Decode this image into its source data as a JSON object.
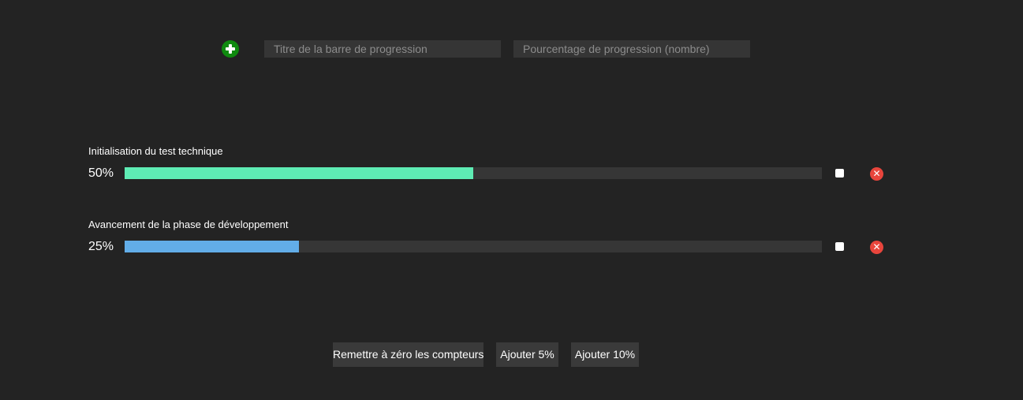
{
  "form": {
    "title_placeholder": "Titre de la barre de progression",
    "percent_placeholder": "Pourcentage de progression (nombre)",
    "add_icon": "plus-circle-icon",
    "add_color": "#0f8a0f"
  },
  "bars": [
    {
      "title": "Initialisation du test technique",
      "percent_label": "50%",
      "progress": 50,
      "color": "#5eecb4",
      "checked": false,
      "delete_icon": "close-circle-icon"
    },
    {
      "title": "Avancement de la phase de développement",
      "percent_label": "25%",
      "progress": 25,
      "color": "#62ade8",
      "checked": false,
      "delete_icon": "close-circle-icon"
    }
  ],
  "actions": {
    "reset_label": "Remettre à zéro les compteurs",
    "add5_label": "Ajouter 5%",
    "add10_label": "Ajouter 10%"
  },
  "colors": {
    "background": "#232323",
    "delete": "#e8453c"
  }
}
